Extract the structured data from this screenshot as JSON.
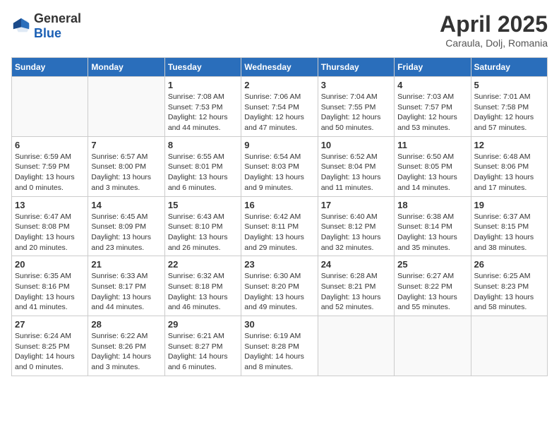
{
  "logo": {
    "general": "General",
    "blue": "Blue"
  },
  "title": "April 2025",
  "subtitle": "Caraula, Dolj, Romania",
  "headers": [
    "Sunday",
    "Monday",
    "Tuesday",
    "Wednesday",
    "Thursday",
    "Friday",
    "Saturday"
  ],
  "weeks": [
    [
      {
        "day": "",
        "sunrise": "",
        "sunset": "",
        "daylight": ""
      },
      {
        "day": "",
        "sunrise": "",
        "sunset": "",
        "daylight": ""
      },
      {
        "day": "1",
        "sunrise": "Sunrise: 7:08 AM",
        "sunset": "Sunset: 7:53 PM",
        "daylight": "Daylight: 12 hours and 44 minutes."
      },
      {
        "day": "2",
        "sunrise": "Sunrise: 7:06 AM",
        "sunset": "Sunset: 7:54 PM",
        "daylight": "Daylight: 12 hours and 47 minutes."
      },
      {
        "day": "3",
        "sunrise": "Sunrise: 7:04 AM",
        "sunset": "Sunset: 7:55 PM",
        "daylight": "Daylight: 12 hours and 50 minutes."
      },
      {
        "day": "4",
        "sunrise": "Sunrise: 7:03 AM",
        "sunset": "Sunset: 7:57 PM",
        "daylight": "Daylight: 12 hours and 53 minutes."
      },
      {
        "day": "5",
        "sunrise": "Sunrise: 7:01 AM",
        "sunset": "Sunset: 7:58 PM",
        "daylight": "Daylight: 12 hours and 57 minutes."
      }
    ],
    [
      {
        "day": "6",
        "sunrise": "Sunrise: 6:59 AM",
        "sunset": "Sunset: 7:59 PM",
        "daylight": "Daylight: 13 hours and 0 minutes."
      },
      {
        "day": "7",
        "sunrise": "Sunrise: 6:57 AM",
        "sunset": "Sunset: 8:00 PM",
        "daylight": "Daylight: 13 hours and 3 minutes."
      },
      {
        "day": "8",
        "sunrise": "Sunrise: 6:55 AM",
        "sunset": "Sunset: 8:01 PM",
        "daylight": "Daylight: 13 hours and 6 minutes."
      },
      {
        "day": "9",
        "sunrise": "Sunrise: 6:54 AM",
        "sunset": "Sunset: 8:03 PM",
        "daylight": "Daylight: 13 hours and 9 minutes."
      },
      {
        "day": "10",
        "sunrise": "Sunrise: 6:52 AM",
        "sunset": "Sunset: 8:04 PM",
        "daylight": "Daylight: 13 hours and 11 minutes."
      },
      {
        "day": "11",
        "sunrise": "Sunrise: 6:50 AM",
        "sunset": "Sunset: 8:05 PM",
        "daylight": "Daylight: 13 hours and 14 minutes."
      },
      {
        "day": "12",
        "sunrise": "Sunrise: 6:48 AM",
        "sunset": "Sunset: 8:06 PM",
        "daylight": "Daylight: 13 hours and 17 minutes."
      }
    ],
    [
      {
        "day": "13",
        "sunrise": "Sunrise: 6:47 AM",
        "sunset": "Sunset: 8:08 PM",
        "daylight": "Daylight: 13 hours and 20 minutes."
      },
      {
        "day": "14",
        "sunrise": "Sunrise: 6:45 AM",
        "sunset": "Sunset: 8:09 PM",
        "daylight": "Daylight: 13 hours and 23 minutes."
      },
      {
        "day": "15",
        "sunrise": "Sunrise: 6:43 AM",
        "sunset": "Sunset: 8:10 PM",
        "daylight": "Daylight: 13 hours and 26 minutes."
      },
      {
        "day": "16",
        "sunrise": "Sunrise: 6:42 AM",
        "sunset": "Sunset: 8:11 PM",
        "daylight": "Daylight: 13 hours and 29 minutes."
      },
      {
        "day": "17",
        "sunrise": "Sunrise: 6:40 AM",
        "sunset": "Sunset: 8:12 PM",
        "daylight": "Daylight: 13 hours and 32 minutes."
      },
      {
        "day": "18",
        "sunrise": "Sunrise: 6:38 AM",
        "sunset": "Sunset: 8:14 PM",
        "daylight": "Daylight: 13 hours and 35 minutes."
      },
      {
        "day": "19",
        "sunrise": "Sunrise: 6:37 AM",
        "sunset": "Sunset: 8:15 PM",
        "daylight": "Daylight: 13 hours and 38 minutes."
      }
    ],
    [
      {
        "day": "20",
        "sunrise": "Sunrise: 6:35 AM",
        "sunset": "Sunset: 8:16 PM",
        "daylight": "Daylight: 13 hours and 41 minutes."
      },
      {
        "day": "21",
        "sunrise": "Sunrise: 6:33 AM",
        "sunset": "Sunset: 8:17 PM",
        "daylight": "Daylight: 13 hours and 44 minutes."
      },
      {
        "day": "22",
        "sunrise": "Sunrise: 6:32 AM",
        "sunset": "Sunset: 8:18 PM",
        "daylight": "Daylight: 13 hours and 46 minutes."
      },
      {
        "day": "23",
        "sunrise": "Sunrise: 6:30 AM",
        "sunset": "Sunset: 8:20 PM",
        "daylight": "Daylight: 13 hours and 49 minutes."
      },
      {
        "day": "24",
        "sunrise": "Sunrise: 6:28 AM",
        "sunset": "Sunset: 8:21 PM",
        "daylight": "Daylight: 13 hours and 52 minutes."
      },
      {
        "day": "25",
        "sunrise": "Sunrise: 6:27 AM",
        "sunset": "Sunset: 8:22 PM",
        "daylight": "Daylight: 13 hours and 55 minutes."
      },
      {
        "day": "26",
        "sunrise": "Sunrise: 6:25 AM",
        "sunset": "Sunset: 8:23 PM",
        "daylight": "Daylight: 13 hours and 58 minutes."
      }
    ],
    [
      {
        "day": "27",
        "sunrise": "Sunrise: 6:24 AM",
        "sunset": "Sunset: 8:25 PM",
        "daylight": "Daylight: 14 hours and 0 minutes."
      },
      {
        "day": "28",
        "sunrise": "Sunrise: 6:22 AM",
        "sunset": "Sunset: 8:26 PM",
        "daylight": "Daylight: 14 hours and 3 minutes."
      },
      {
        "day": "29",
        "sunrise": "Sunrise: 6:21 AM",
        "sunset": "Sunset: 8:27 PM",
        "daylight": "Daylight: 14 hours and 6 minutes."
      },
      {
        "day": "30",
        "sunrise": "Sunrise: 6:19 AM",
        "sunset": "Sunset: 8:28 PM",
        "daylight": "Daylight: 14 hours and 8 minutes."
      },
      {
        "day": "",
        "sunrise": "",
        "sunset": "",
        "daylight": ""
      },
      {
        "day": "",
        "sunrise": "",
        "sunset": "",
        "daylight": ""
      },
      {
        "day": "",
        "sunrise": "",
        "sunset": "",
        "daylight": ""
      }
    ]
  ]
}
